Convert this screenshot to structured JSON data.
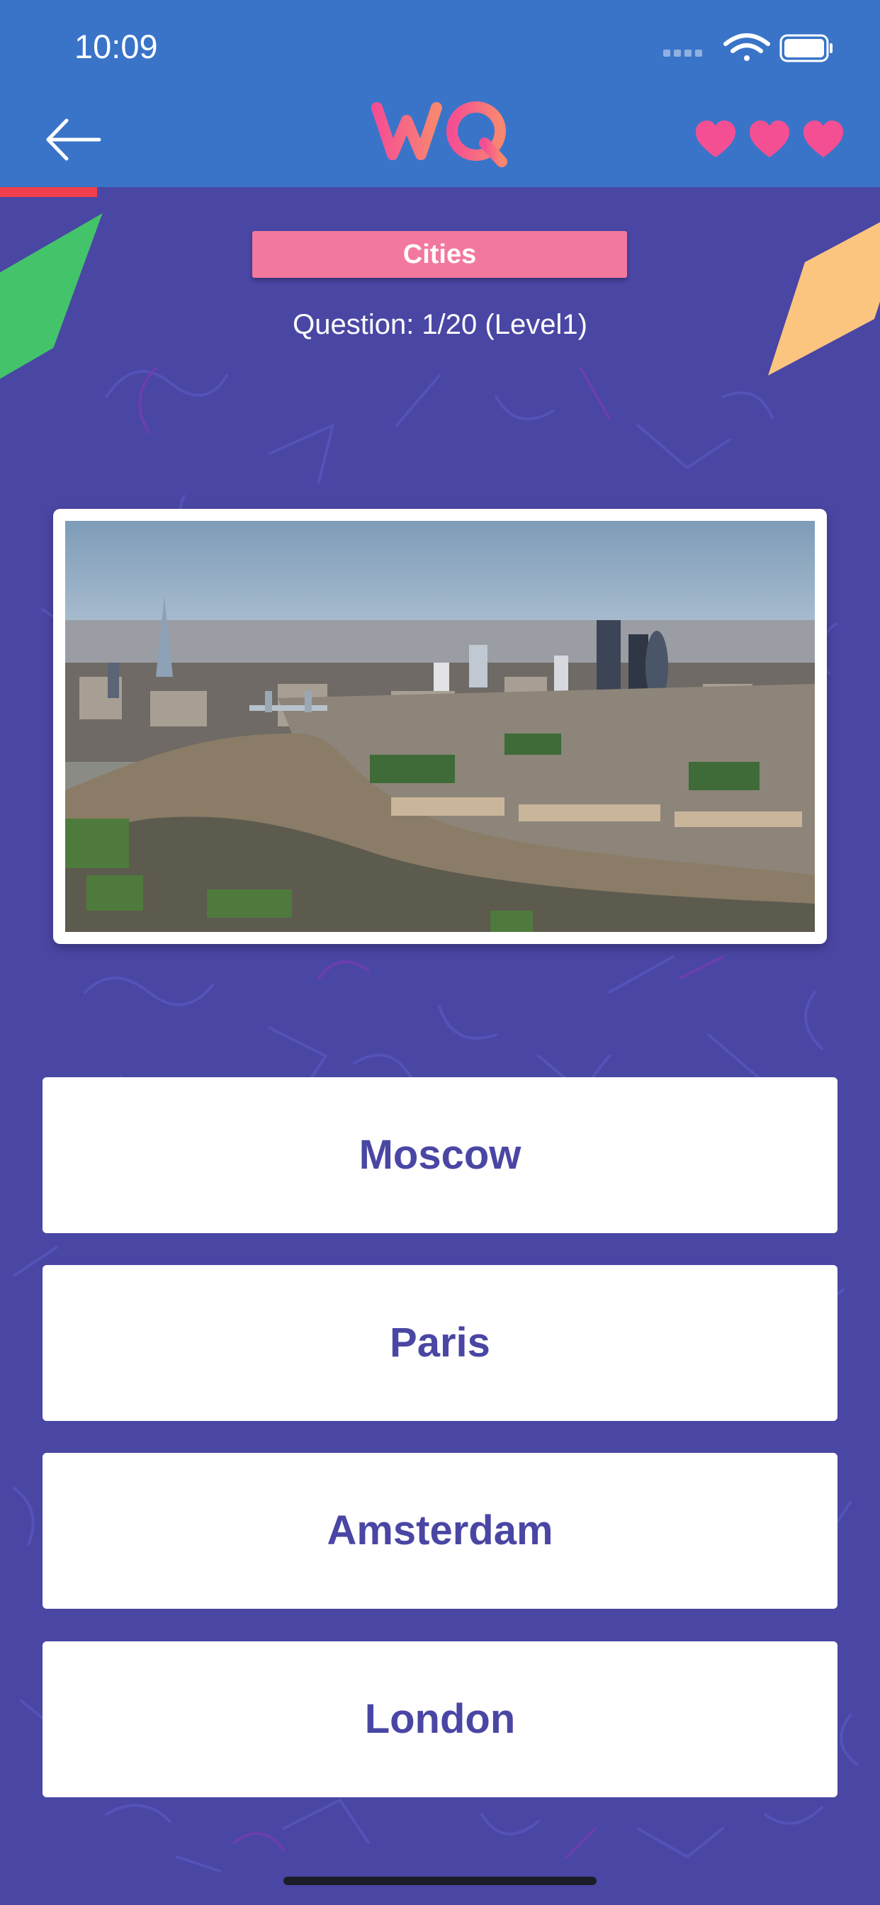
{
  "status_bar": {
    "time": "10:09"
  },
  "header": {
    "logo_text": "WQ",
    "lives": 3,
    "colors": {
      "bar": "#3a74c9",
      "logo_pink": "#f54f93",
      "logo_orange": "#f88770",
      "heart": "#f54f93"
    }
  },
  "progress": {
    "fraction": 0.05
  },
  "quiz": {
    "category": "Cities",
    "question_info": "Question: 1/20 (Level1)"
  },
  "answers": [
    {
      "label": "Moscow"
    },
    {
      "label": "Paris"
    },
    {
      "label": "Amsterdam"
    },
    {
      "label": "London"
    }
  ],
  "colors": {
    "background": "#4a46a4",
    "badge": "#f2789e",
    "answer_text": "#4a46a4",
    "progress": "#ef3f4d"
  }
}
